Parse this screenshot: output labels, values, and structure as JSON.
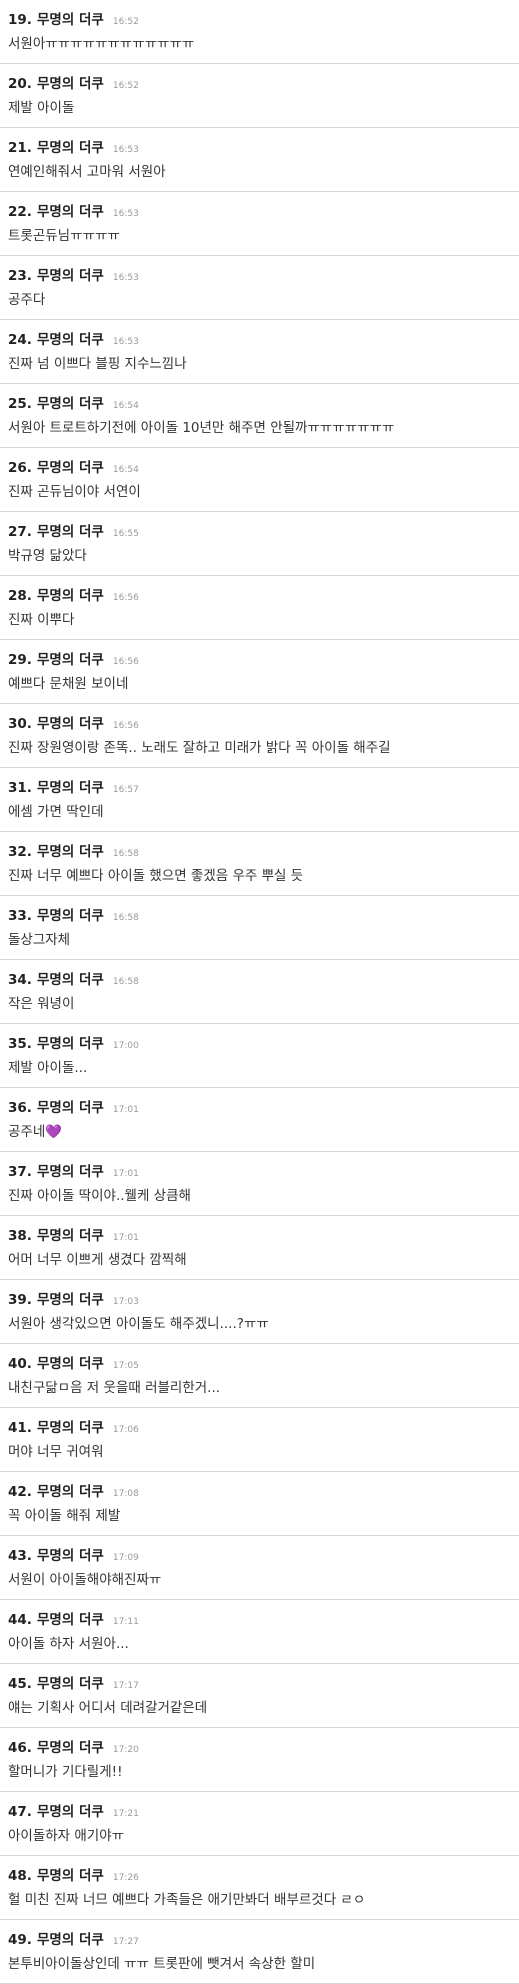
{
  "comments": [
    {
      "num": "19.",
      "author": "무명의 더쿠",
      "time": "16:52",
      "text": "서원아ㅠㅠㅠㅠㅠㅠㅠㅠㅠㅠㅠㅠ"
    },
    {
      "num": "20.",
      "author": "무명의 더쿠",
      "time": "16:52",
      "text": "제발 아이돌"
    },
    {
      "num": "21.",
      "author": "무명의 더쿠",
      "time": "16:53",
      "text": "연예인해줘서 고마워 서원아"
    },
    {
      "num": "22.",
      "author": "무명의 더쿠",
      "time": "16:53",
      "text": "트롯곤듀님ㅠㅠㅠㅠ"
    },
    {
      "num": "23.",
      "author": "무명의 더쿠",
      "time": "16:53",
      "text": "공주다"
    },
    {
      "num": "24.",
      "author": "무명의 더쿠",
      "time": "16:53",
      "text": "진짜 넘 이쁘다 블핑 지수느낌나"
    },
    {
      "num": "25.",
      "author": "무명의 더쿠",
      "time": "16:54",
      "text": "서원아 트로트하기전에 아이돌 10년만 해주면 안될까ㅠㅠㅠㅠㅠㅠㅠ"
    },
    {
      "num": "26.",
      "author": "무명의 더쿠",
      "time": "16:54",
      "text": "진짜 곤듀님이야 서연이"
    },
    {
      "num": "27.",
      "author": "무명의 더쿠",
      "time": "16:55",
      "text": "박규영 닮았다"
    },
    {
      "num": "28.",
      "author": "무명의 더쿠",
      "time": "16:56",
      "text": "진짜 이뿌다"
    },
    {
      "num": "29.",
      "author": "무명의 더쿠",
      "time": "16:56",
      "text": "예쁘다 문채원 보이네"
    },
    {
      "num": "30.",
      "author": "무명의 더쿠",
      "time": "16:56",
      "text": "진짜 장원영이랑 존똑.. 노래도 잘하고 미래가 밝다 꼭 아이돌 해주길"
    },
    {
      "num": "31.",
      "author": "무명의 더쿠",
      "time": "16:57",
      "text": "에셈 가면 딱인데"
    },
    {
      "num": "32.",
      "author": "무명의 더쿠",
      "time": "16:58",
      "text": "진짜 너무 예쁘다 아이돌 했으면 좋겠음 우주 뿌실 듯"
    },
    {
      "num": "33.",
      "author": "무명의 더쿠",
      "time": "16:58",
      "text": "돌상그자체"
    },
    {
      "num": "34.",
      "author": "무명의 더쿠",
      "time": "16:58",
      "text": "작은 워녕이"
    },
    {
      "num": "35.",
      "author": "무명의 더쿠",
      "time": "17:00",
      "text": "제발 아이돌..."
    },
    {
      "num": "36.",
      "author": "무명의 더쿠",
      "time": "17:01",
      "text": "공주네💜"
    },
    {
      "num": "37.",
      "author": "무명의 더쿠",
      "time": "17:01",
      "text": "진짜 아이돌 딱이야..웰케 상큼해"
    },
    {
      "num": "38.",
      "author": "무명의 더쿠",
      "time": "17:01",
      "text": "어머 너무 이쁘게 생겼다 깜찍해"
    },
    {
      "num": "39.",
      "author": "무명의 더쿠",
      "time": "17:03",
      "text": "서원아 생각있으면 아이돌도 해주겠니....?ㅠㅠ"
    },
    {
      "num": "40.",
      "author": "무명의 더쿠",
      "time": "17:05",
      "text": "내친구닮ㅁ음 저 웃을때 러블리한거..."
    },
    {
      "num": "41.",
      "author": "무명의 더쿠",
      "time": "17:06",
      "text": "머야 너무 귀여워"
    },
    {
      "num": "42.",
      "author": "무명의 더쿠",
      "time": "17:08",
      "text": "꼭 아이돌 해줘 제발"
    },
    {
      "num": "43.",
      "author": "무명의 더쿠",
      "time": "17:09",
      "text": "서원이 아이돌해야해진짜ㅠ"
    },
    {
      "num": "44.",
      "author": "무명의 더쿠",
      "time": "17:11",
      "text": "아이돌 하자 서원아..."
    },
    {
      "num": "45.",
      "author": "무명의 더쿠",
      "time": "17:17",
      "text": "얘는 기획사 어디서 데려갈거같은데"
    },
    {
      "num": "46.",
      "author": "무명의 더쿠",
      "time": "17:20",
      "text": "할머니가 기다릴게!!"
    },
    {
      "num": "47.",
      "author": "무명의 더쿠",
      "time": "17:21",
      "text": "아이돌하자 애기야ㅠ"
    },
    {
      "num": "48.",
      "author": "무명의 더쿠",
      "time": "17:26",
      "text": "헐 미친 진짜 너므 예쁘다 가족들은 애기만봐더 배부르것다 ㄹㅇ"
    },
    {
      "num": "49.",
      "author": "무명의 더쿠",
      "time": "17:27",
      "text": "본투비아이돌상인데 ㅠㅠ 트롯판에 뺏겨서 속상한 할미"
    }
  ]
}
